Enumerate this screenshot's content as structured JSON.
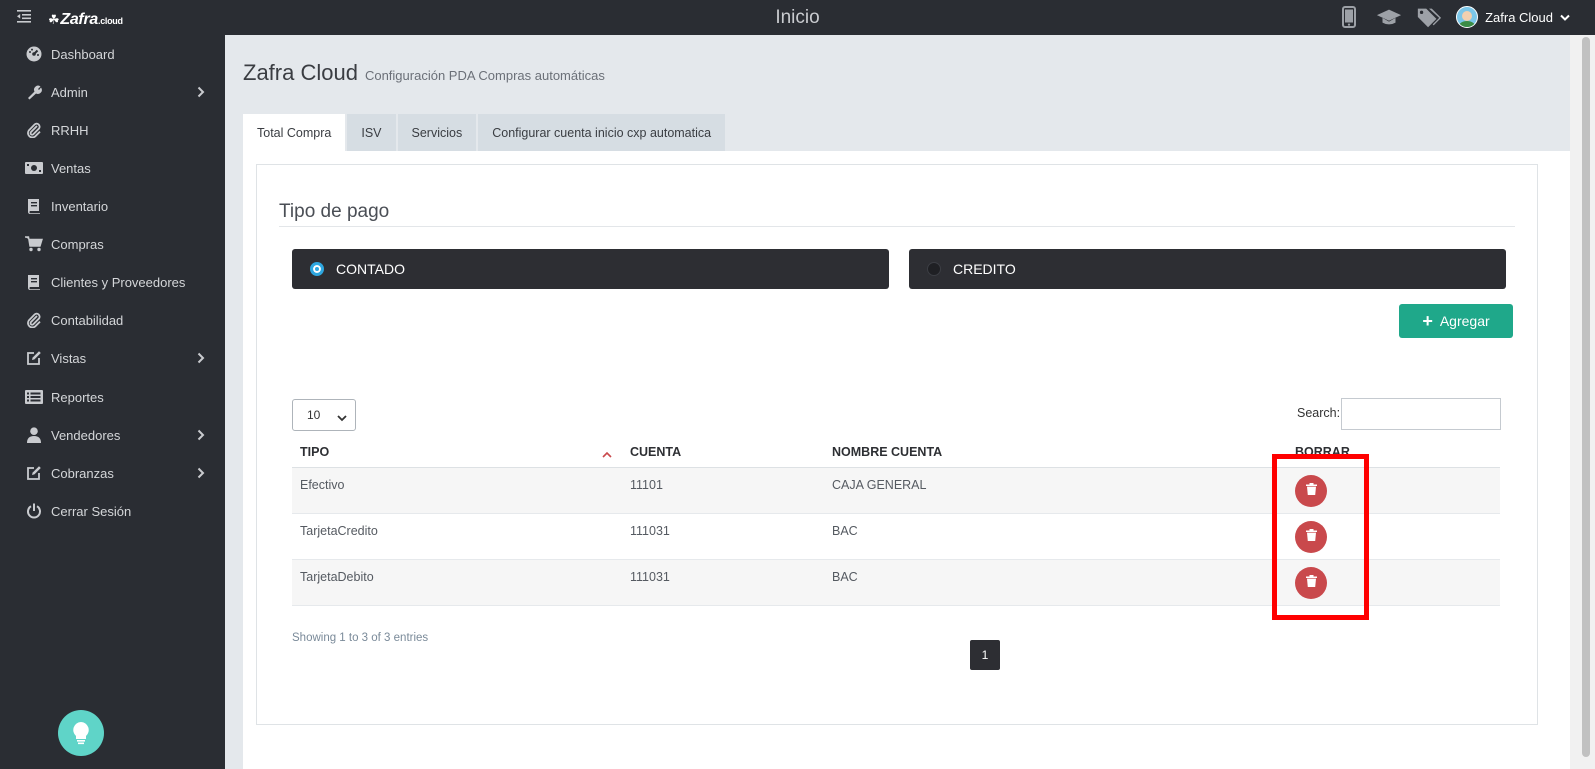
{
  "app": {
    "logo_text": "Zafra",
    "logo_suffix": ".cloud",
    "page_heading": "Inicio",
    "user_name": "Zafra Cloud"
  },
  "sidebar": {
    "items": [
      {
        "label": "Dashboard",
        "icon": "dashboard-icon"
      },
      {
        "label": "Admin",
        "icon": "wrench-icon",
        "has_submenu": true
      },
      {
        "label": "RRHH",
        "icon": "paperclip-icon"
      },
      {
        "label": "Ventas",
        "icon": "money-icon"
      },
      {
        "label": "Inventario",
        "icon": "book-icon"
      },
      {
        "label": "Compras",
        "icon": "cart-icon"
      },
      {
        "label": "Clientes y Proveedores",
        "icon": "book-icon"
      },
      {
        "label": "Contabilidad",
        "icon": "paperclip-icon"
      },
      {
        "label": "Vistas",
        "icon": "edit-icon",
        "has_submenu": true
      },
      {
        "label": "Reportes",
        "icon": "list-icon"
      },
      {
        "label": "Vendedores",
        "icon": "user-icon",
        "has_submenu": true
      },
      {
        "label": "Cobranzas",
        "icon": "edit-icon",
        "has_submenu": true
      },
      {
        "label": "Cerrar Sesión",
        "icon": "power-icon"
      }
    ]
  },
  "header": {
    "title": "Zafra Cloud",
    "subtitle": "Configuración PDA Compras automáticas"
  },
  "tabs": [
    {
      "label": "Total Compra",
      "active": true
    },
    {
      "label": "ISV",
      "active": false
    },
    {
      "label": "Servicios",
      "active": false
    },
    {
      "label": "Configurar cuenta inicio cxp automatica",
      "active": false
    }
  ],
  "panel": {
    "section_title": "Tipo de pago",
    "payment_types": [
      {
        "label": "CONTADO",
        "selected": true
      },
      {
        "label": "CREDITO",
        "selected": false
      }
    ],
    "add_button": "Agregar"
  },
  "table": {
    "length_value": "10",
    "search_label": "Search:",
    "search_value": "",
    "columns": [
      "TIPO",
      "CUENTA",
      "NOMBRE CUENTA",
      "BORRAR"
    ],
    "rows": [
      {
        "tipo": "Efectivo",
        "cuenta": "11101",
        "nombre": "CAJA GENERAL"
      },
      {
        "tipo": "TarjetaCredito",
        "cuenta": "111031",
        "nombre": "BAC"
      },
      {
        "tipo": "TarjetaDebito",
        "cuenta": "111031",
        "nombre": "BAC"
      }
    ],
    "info": "Showing 1 to 3 of 3 entries",
    "current_page": "1"
  },
  "colors": {
    "accent": "#1fa88a",
    "delete": "#c9494c",
    "highlight": "#ff0000",
    "sidebar_bg": "#2a2d33"
  }
}
